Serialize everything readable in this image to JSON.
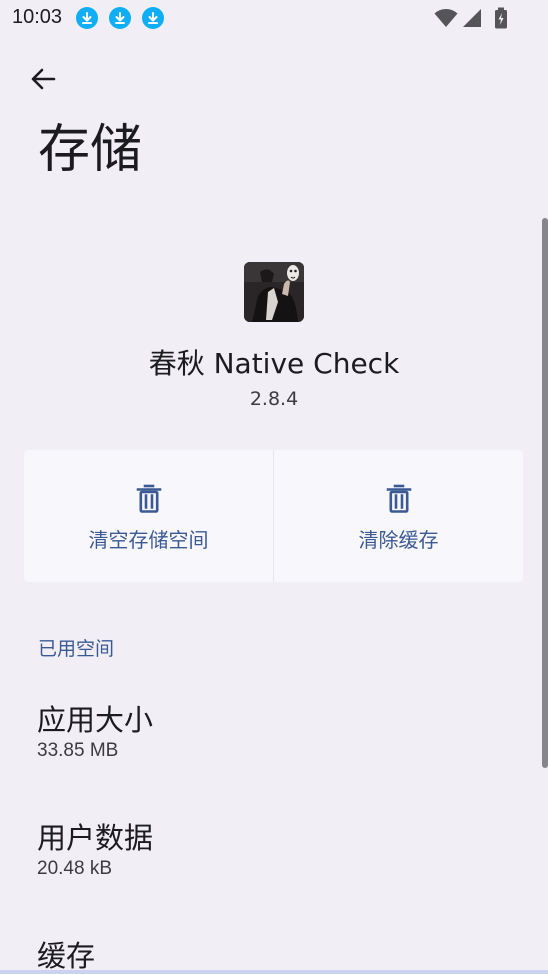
{
  "status_bar": {
    "time": "10:03",
    "notification_icons": [
      "download-icon",
      "download-icon",
      "download-icon"
    ],
    "right_icons": [
      "wifi-icon",
      "signal-icon",
      "battery-icon"
    ]
  },
  "header": {
    "back_icon": "arrow-back-icon",
    "title": "存储"
  },
  "app": {
    "name": "春秋 Native Check",
    "version": "2.8.4"
  },
  "actions": [
    {
      "label": "清空存储空间",
      "icon": "trash-icon"
    },
    {
      "label": "清除缓存",
      "icon": "trash-icon"
    }
  ],
  "section": {
    "title": "已用空间"
  },
  "stats": [
    {
      "title": "应用大小",
      "value": "33.85 MB"
    },
    {
      "title": "用户数据",
      "value": "20.48 kB"
    },
    {
      "title": "缓存",
      "value": ""
    }
  ],
  "colors": {
    "background": "#f1eff5",
    "accent": "#3b5a94",
    "download_badge": "#10aef5"
  }
}
